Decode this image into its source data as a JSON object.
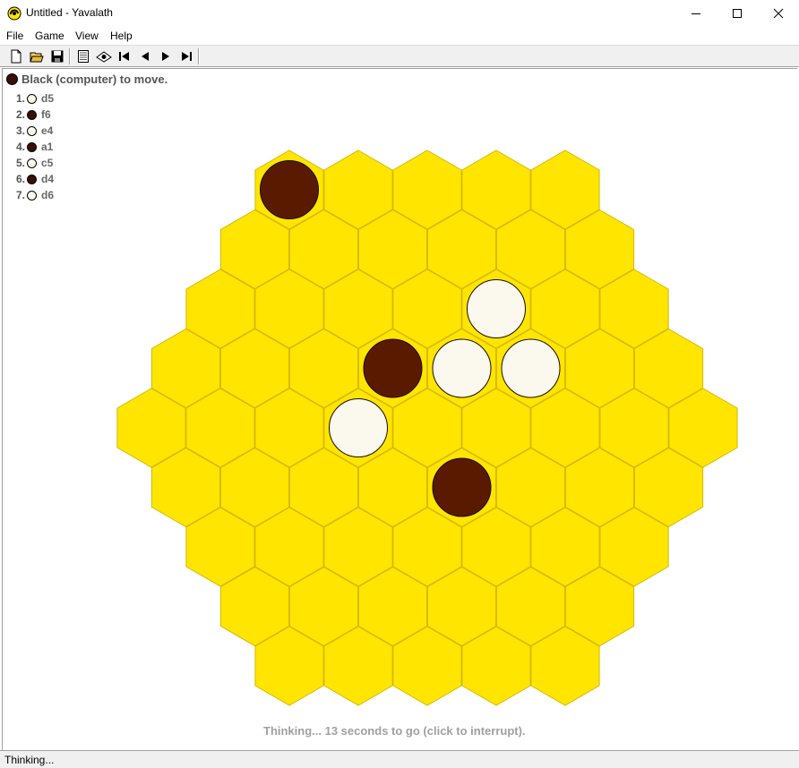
{
  "window": {
    "title": "Untitled - Yavalath",
    "icon": "yavalath-app-icon",
    "controls": [
      "minimize-icon",
      "maximize-icon",
      "close-icon"
    ]
  },
  "menu": [
    "File",
    "Game",
    "View",
    "Help"
  ],
  "toolbar": [
    "new-icon",
    "open-icon",
    "save-icon",
    "move-list-icon",
    "hint-icon",
    "first-move-icon",
    "previous-move-icon",
    "next-move-icon",
    "last-move-icon"
  ],
  "status_line": {
    "text": "Black (computer) to move.",
    "color": "black"
  },
  "moves": [
    {
      "num": "1.",
      "color": "white",
      "cell": "d5"
    },
    {
      "num": "2.",
      "color": "black",
      "cell": "f6"
    },
    {
      "num": "3.",
      "color": "white",
      "cell": "e4"
    },
    {
      "num": "4.",
      "color": "black",
      "cell": "a1"
    },
    {
      "num": "5.",
      "color": "white",
      "cell": "c5"
    },
    {
      "num": "6.",
      "color": "black",
      "cell": "d4"
    },
    {
      "num": "7.",
      "color": "white",
      "cell": "d6"
    }
  ],
  "board": {
    "side": 5,
    "cell_color": "#ffe500",
    "cell_stroke": "#d4b800",
    "black_color": "#5a1a00",
    "white_color": "#fbf8ee",
    "pieces": [
      {
        "row": 0,
        "col": 0,
        "color": "black"
      },
      {
        "row": 2,
        "col": 4,
        "color": "white"
      },
      {
        "row": 3,
        "col": 3,
        "color": "black"
      },
      {
        "row": 3,
        "col": 4,
        "color": "white"
      },
      {
        "row": 3,
        "col": 5,
        "color": "white"
      },
      {
        "row": 4,
        "col": 3,
        "color": "white"
      },
      {
        "row": 5,
        "col": 4,
        "color": "black"
      }
    ]
  },
  "thinking_text": "Thinking...  13 seconds to go (click to interrupt).",
  "statusbar_text": "Thinking..."
}
